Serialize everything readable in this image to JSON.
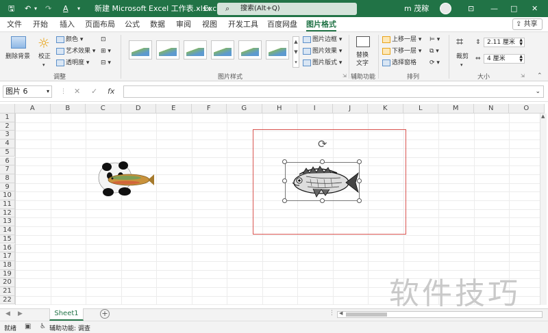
{
  "titlebar": {
    "document_title": "新建 Microsoft Excel 工作表.xlsx",
    "app_name": "Excel",
    "search_placeholder": "搜索(Alt+Q)",
    "user_name": "m 茂稼",
    "minimize": "—",
    "maximize": "□",
    "close": "✕",
    "layout_btn": "⊡"
  },
  "tabs": [
    "文件",
    "开始",
    "插入",
    "页面布局",
    "公式",
    "数据",
    "审阅",
    "视图",
    "开发工具",
    "百度网盘",
    "图片格式"
  ],
  "active_tab": "图片格式",
  "share_label": "共享",
  "ribbon": {
    "remove_bg": "删除背景",
    "corrections": "校正",
    "color": "颜色",
    "artistic": "艺术效果",
    "transparency": "透明度",
    "adjust_group": "调整",
    "picture_styles_group": "图片样式",
    "border": "图片边框",
    "effects": "图片效果",
    "layout": "图片版式",
    "alt_text_line1": "替换",
    "alt_text_line2": "文字",
    "accessibility_group": "辅助功能",
    "bring_forward": "上移一层",
    "send_backward": "下移一层",
    "selection_pane": "选择窗格",
    "arrange_group": "排列",
    "crop": "裁剪",
    "height": "2.11 厘米",
    "width": "4 厘米",
    "size_group": "大小"
  },
  "formula_bar": {
    "name_box": "图片 6",
    "cancel": "✕",
    "enter": "✓",
    "fx": "fx",
    "content": ""
  },
  "columns": [
    "A",
    "B",
    "C",
    "D",
    "E",
    "F",
    "G",
    "H",
    "I",
    "J",
    "K",
    "L",
    "M",
    "N",
    "O"
  ],
  "rows": [
    "1",
    "2",
    "3",
    "4",
    "5",
    "6",
    "7",
    "8",
    "9",
    "10",
    "11",
    "12",
    "13",
    "14",
    "15",
    "16",
    "17",
    "18",
    "19",
    "20",
    "21",
    "22"
  ],
  "sheet_tab": "Sheet1",
  "add_sheet": "+",
  "status": {
    "ready": "就绪",
    "accessibility": "辅助功能: 调查"
  },
  "watermark": "软件技巧",
  "colors": {
    "excel_green": "#217346",
    "selection_border": "#d9534f"
  }
}
